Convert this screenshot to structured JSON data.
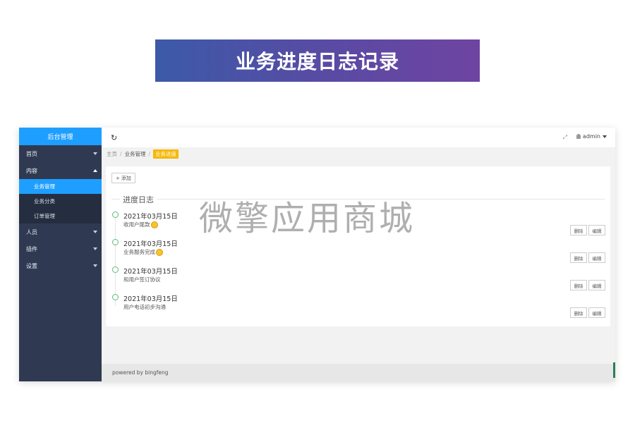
{
  "banner": {
    "title": "业务进度日志记录"
  },
  "sidebar": {
    "logo": "后台管理",
    "items": [
      {
        "label": "首页",
        "expanded": false
      },
      {
        "label": "内容",
        "expanded": true,
        "children": [
          {
            "label": "业务管理",
            "active": true
          },
          {
            "label": "业务分类",
            "active": false
          },
          {
            "label": "订单管理",
            "active": false
          }
        ]
      },
      {
        "label": "人员",
        "expanded": false
      },
      {
        "label": "插件",
        "expanded": false
      },
      {
        "label": "设置",
        "expanded": false
      }
    ]
  },
  "topbar": {
    "refresh_icon": "refresh-icon",
    "fullscreen_icon": "fullscreen-icon",
    "user": "admin"
  },
  "breadcrumb": {
    "home": "主页",
    "sep": "/",
    "parent": "业务管理",
    "current": "业务进度"
  },
  "toolbar": {
    "add_label": "添加"
  },
  "timeline": {
    "title": "进度日志",
    "entries": [
      {
        "date": "2021年03月15日",
        "text": "收用户尾款",
        "emoji": "grinning-face-icon",
        "delete_label": "删除",
        "edit_label": "编辑"
      },
      {
        "date": "2021年03月15日",
        "text": "业务服务完成",
        "emoji": "smiling-face-icon",
        "delete_label": "删除",
        "edit_label": "编辑"
      },
      {
        "date": "2021年03月15日",
        "text": "和用户签订协议",
        "delete_label": "删除",
        "edit_label": "编辑"
      },
      {
        "date": "2021年03月15日",
        "text": "用户电话初步沟通",
        "delete_label": "删除",
        "edit_label": "编辑"
      }
    ]
  },
  "footer": {
    "text": "powered by bingfeng"
  },
  "watermark": {
    "text": "微擎应用商城"
  },
  "colors": {
    "accent": "#1e9fff",
    "sidebar": "#2f3a52",
    "badge": "#f5b800",
    "timeline_dot": "#5fb878"
  }
}
